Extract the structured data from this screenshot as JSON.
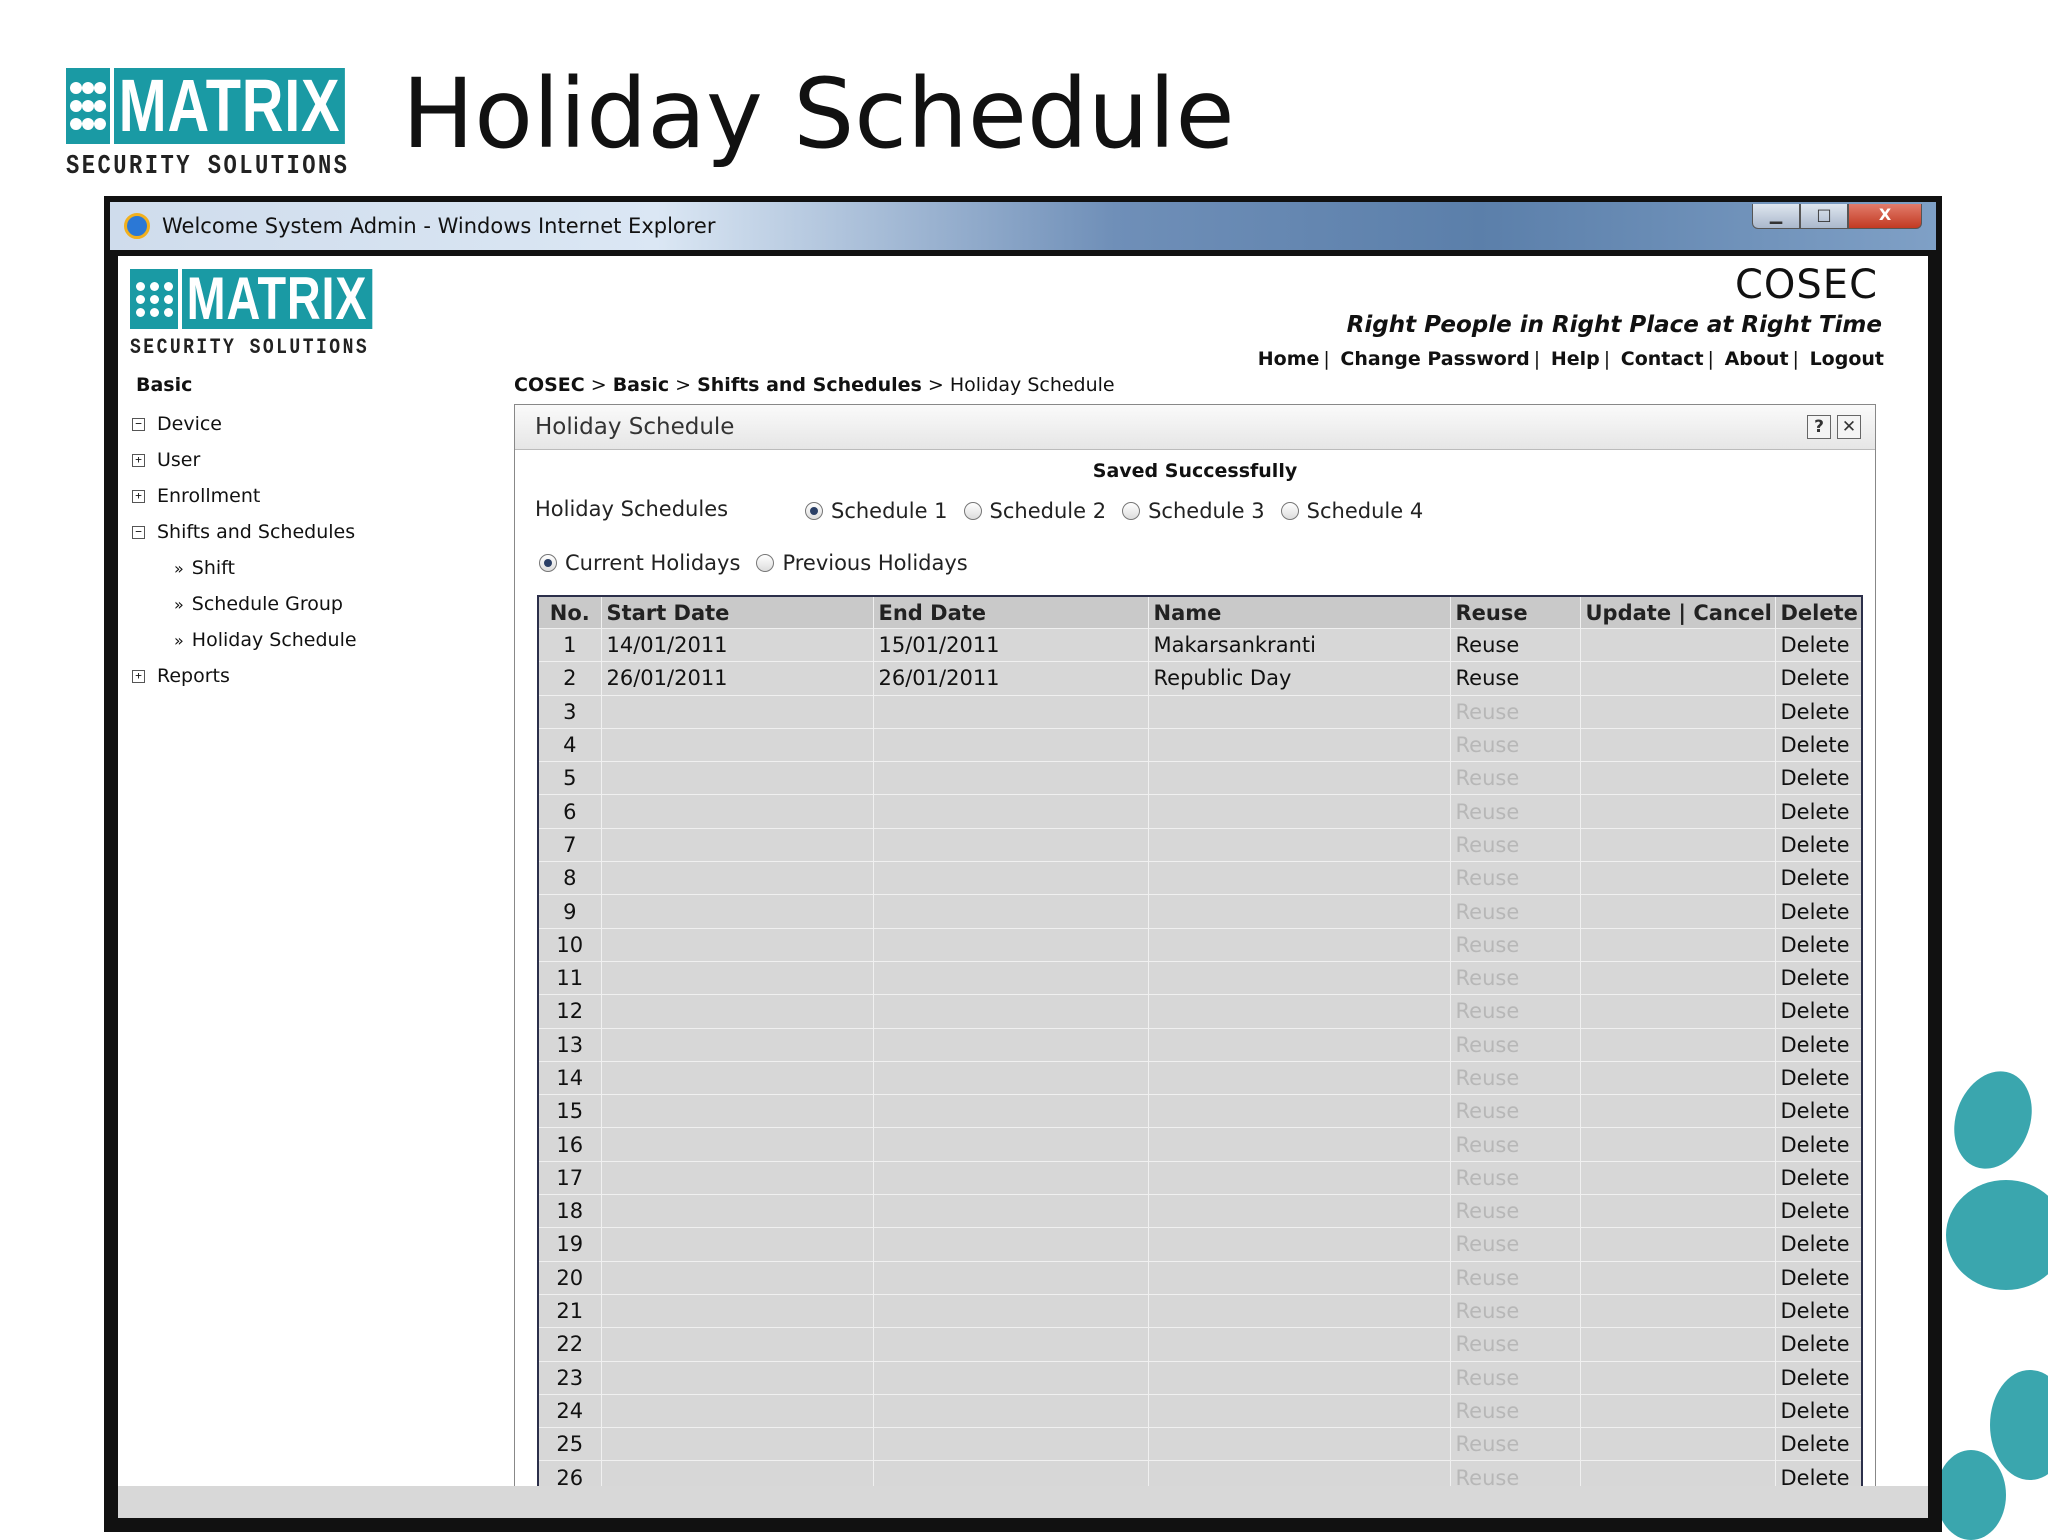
{
  "slide": {
    "logo_text": "MATRIX",
    "logo_sub": "SECURITY SOLUTIONS",
    "title": "Holiday Schedule"
  },
  "window": {
    "title": "Welcome System Admin - Windows Internet Explorer",
    "minimize_glyph": "▁",
    "maximize_glyph": "□",
    "close_glyph": "X"
  },
  "app": {
    "logo_text": "MATRIX",
    "logo_sub": "SECURITY SOLUTIONS",
    "brand": "COSEC",
    "tagline": "Right People in Right Place at Right Time",
    "links": [
      "Home",
      "Change Password",
      "Help",
      "Contact",
      "About",
      "Logout"
    ]
  },
  "sidebar": {
    "heading": "Basic",
    "items": [
      {
        "label": "Device",
        "toggle": "−"
      },
      {
        "label": "User",
        "toggle": "+"
      },
      {
        "label": "Enrollment",
        "toggle": "+"
      },
      {
        "label": "Shifts and Schedules",
        "toggle": "−"
      }
    ],
    "subitems": [
      "Shift",
      "Schedule Group",
      "Holiday Schedule"
    ],
    "reports": {
      "label": "Reports",
      "toggle": "+"
    },
    "chevron": "»"
  },
  "breadcrumb": {
    "parts": [
      "COSEC",
      "Basic",
      "Shifts and Schedules"
    ],
    "current": "Holiday Schedule",
    "sep": " > "
  },
  "panel": {
    "title": "Holiday Schedule",
    "help_glyph": "?",
    "close_glyph": "✕",
    "status": "Saved Successfully",
    "schedules_label": "Holiday Schedules",
    "schedules": [
      "Schedule 1",
      "Schedule 2",
      "Schedule 3",
      "Schedule 4"
    ],
    "selected_schedule": "Schedule 1",
    "views": [
      "Current Holidays",
      "Previous Holidays"
    ],
    "selected_view": "Current Holidays"
  },
  "table": {
    "headers": [
      "No.",
      "Start Date",
      "End Date",
      "Name",
      "Reuse",
      "Update | Cancel",
      "Delete"
    ],
    "rows": [
      {
        "no": "1",
        "start": "14/01/2011",
        "end": "15/01/2011",
        "name": "Makarsankranti",
        "reuse": "Reuse",
        "reuse_enabled": true,
        "update": "",
        "delete": "Delete"
      },
      {
        "no": "2",
        "start": "26/01/2011",
        "end": "26/01/2011",
        "name": "Republic Day",
        "reuse": "Reuse",
        "reuse_enabled": true,
        "update": "",
        "delete": "Delete"
      },
      {
        "no": "3",
        "start": "",
        "end": "",
        "name": "",
        "reuse": "Reuse",
        "reuse_enabled": false,
        "update": "",
        "delete": "Delete"
      },
      {
        "no": "4",
        "start": "",
        "end": "",
        "name": "",
        "reuse": "Reuse",
        "reuse_enabled": false,
        "update": "",
        "delete": "Delete"
      },
      {
        "no": "5",
        "start": "",
        "end": "",
        "name": "",
        "reuse": "Reuse",
        "reuse_enabled": false,
        "update": "",
        "delete": "Delete"
      },
      {
        "no": "6",
        "start": "",
        "end": "",
        "name": "",
        "reuse": "Reuse",
        "reuse_enabled": false,
        "update": "",
        "delete": "Delete"
      },
      {
        "no": "7",
        "start": "",
        "end": "",
        "name": "",
        "reuse": "Reuse",
        "reuse_enabled": false,
        "update": "",
        "delete": "Delete"
      },
      {
        "no": "8",
        "start": "",
        "end": "",
        "name": "",
        "reuse": "Reuse",
        "reuse_enabled": false,
        "update": "",
        "delete": "Delete"
      },
      {
        "no": "9",
        "start": "",
        "end": "",
        "name": "",
        "reuse": "Reuse",
        "reuse_enabled": false,
        "update": "",
        "delete": "Delete"
      },
      {
        "no": "10",
        "start": "",
        "end": "",
        "name": "",
        "reuse": "Reuse",
        "reuse_enabled": false,
        "update": "",
        "delete": "Delete"
      },
      {
        "no": "11",
        "start": "",
        "end": "",
        "name": "",
        "reuse": "Reuse",
        "reuse_enabled": false,
        "update": "",
        "delete": "Delete"
      },
      {
        "no": "12",
        "start": "",
        "end": "",
        "name": "",
        "reuse": "Reuse",
        "reuse_enabled": false,
        "update": "",
        "delete": "Delete"
      },
      {
        "no": "13",
        "start": "",
        "end": "",
        "name": "",
        "reuse": "Reuse",
        "reuse_enabled": false,
        "update": "",
        "delete": "Delete"
      },
      {
        "no": "14",
        "start": "",
        "end": "",
        "name": "",
        "reuse": "Reuse",
        "reuse_enabled": false,
        "update": "",
        "delete": "Delete"
      },
      {
        "no": "15",
        "start": "",
        "end": "",
        "name": "",
        "reuse": "Reuse",
        "reuse_enabled": false,
        "update": "",
        "delete": "Delete"
      },
      {
        "no": "16",
        "start": "",
        "end": "",
        "name": "",
        "reuse": "Reuse",
        "reuse_enabled": false,
        "update": "",
        "delete": "Delete"
      },
      {
        "no": "17",
        "start": "",
        "end": "",
        "name": "",
        "reuse": "Reuse",
        "reuse_enabled": false,
        "update": "",
        "delete": "Delete"
      },
      {
        "no": "18",
        "start": "",
        "end": "",
        "name": "",
        "reuse": "Reuse",
        "reuse_enabled": false,
        "update": "",
        "delete": "Delete"
      },
      {
        "no": "19",
        "start": "",
        "end": "",
        "name": "",
        "reuse": "Reuse",
        "reuse_enabled": false,
        "update": "",
        "delete": "Delete"
      },
      {
        "no": "20",
        "start": "",
        "end": "",
        "name": "",
        "reuse": "Reuse",
        "reuse_enabled": false,
        "update": "",
        "delete": "Delete"
      },
      {
        "no": "21",
        "start": "",
        "end": "",
        "name": "",
        "reuse": "Reuse",
        "reuse_enabled": false,
        "update": "",
        "delete": "Delete"
      },
      {
        "no": "22",
        "start": "",
        "end": "",
        "name": "",
        "reuse": "Reuse",
        "reuse_enabled": false,
        "update": "",
        "delete": "Delete"
      },
      {
        "no": "23",
        "start": "",
        "end": "",
        "name": "",
        "reuse": "Reuse",
        "reuse_enabled": false,
        "update": "",
        "delete": "Delete"
      },
      {
        "no": "24",
        "start": "",
        "end": "",
        "name": "",
        "reuse": "Reuse",
        "reuse_enabled": false,
        "update": "",
        "delete": "Delete"
      },
      {
        "no": "25",
        "start": "",
        "end": "",
        "name": "",
        "reuse": "Reuse",
        "reuse_enabled": false,
        "update": "",
        "delete": "Delete"
      },
      {
        "no": "26",
        "start": "",
        "end": "",
        "name": "",
        "reuse": "Reuse",
        "reuse_enabled": false,
        "update": "",
        "delete": "Delete"
      }
    ]
  },
  "colors": {
    "brand_teal": "#1a9aa4",
    "blob_teal": "#3aa6ae",
    "grid_bg": "#d7d7d7",
    "disabled_text": "#b7b7b7"
  }
}
